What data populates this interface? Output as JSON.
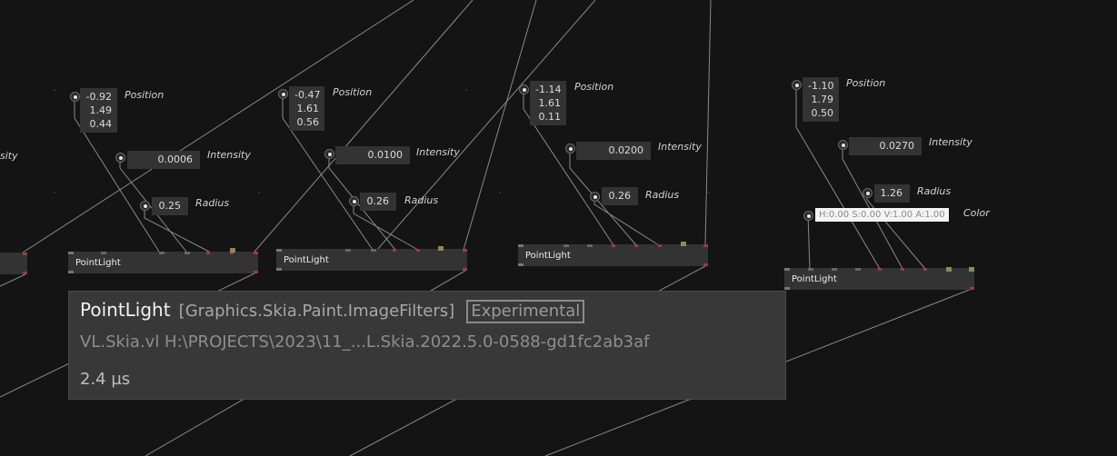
{
  "labels": {
    "position": "Position",
    "intensity": "Intensity",
    "radius": "Radius",
    "color": "Color",
    "partial": "sity"
  },
  "node_title": "PointLight",
  "groups": [
    {
      "position": [
        "-0.92",
        "1.49",
        "0.44"
      ],
      "intensity": "0.0006",
      "radius": "0.25"
    },
    {
      "position": [
        "-0.47",
        "1.61",
        "0.56"
      ],
      "intensity": "0.0100",
      "radius": "0.26"
    },
    {
      "position": [
        "-1.14",
        "1.61",
        "0.11"
      ],
      "intensity": "0.0200",
      "radius": "0.26"
    },
    {
      "position": [
        "-1.10",
        "1.79",
        "0.50"
      ],
      "intensity": "0.0270",
      "radius": "1.26",
      "color": "H:0.00 S:0.00 V:1.00 A:1.00"
    }
  ],
  "tooltip": {
    "name": "PointLight",
    "category": "[Graphics.Skia.Paint.ImageFilters]",
    "badge": "Experimental",
    "path": "VL.Skia.vl   H:\\PROJECTS\\2023\\11_...L.Skia.2022.5.0-0588-gd1fc2ab3af",
    "time": "2.4 µs"
  },
  "colors": {
    "background": "#141414",
    "node": "#333333",
    "pin_red": "#a23a3a",
    "pin_gray": "#777777",
    "pin_olive": "#8f8a55",
    "wire": "#8a8a8a"
  }
}
